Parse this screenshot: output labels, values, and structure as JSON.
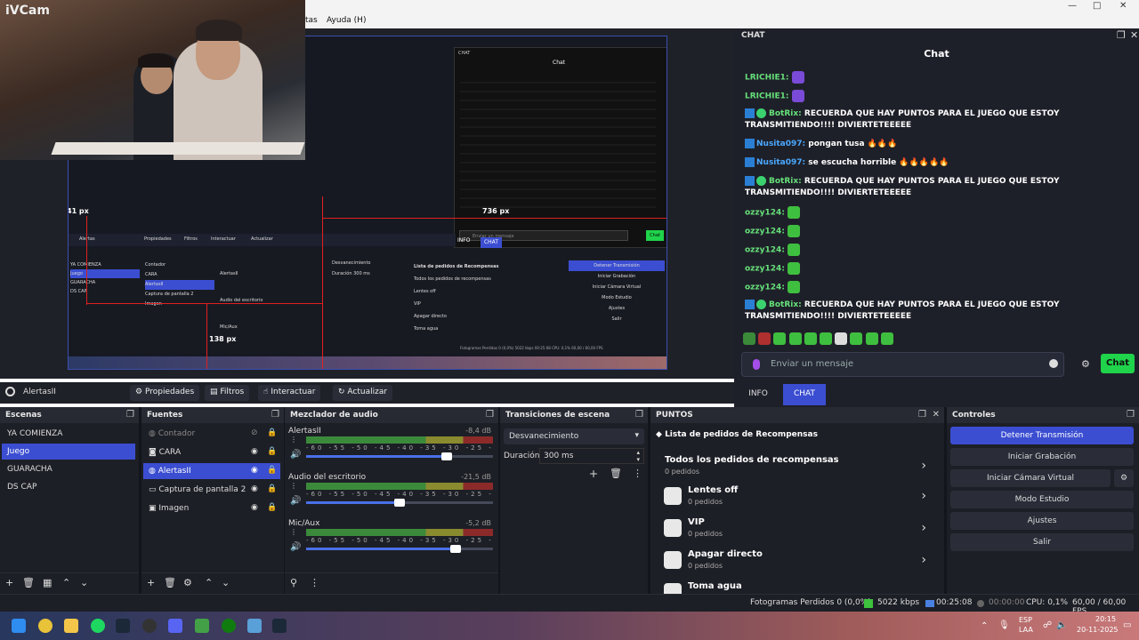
{
  "menu": {
    "item1": "tas",
    "item2": "Ayuda (H)"
  },
  "webcam": {
    "label": "iVCam"
  },
  "preview": {
    "marker_left": "41 px",
    "marker_bottom": "138 px",
    "marker_chat": "736 px",
    "nested_chat_title": "Chat",
    "nested_chat_header": "CHAT",
    "nested_tabs": [
      "INFO",
      "CHAT"
    ],
    "nested_send": "Chat",
    "nested_input_placeholder": "Enviar un mensaje",
    "nested_source": "Alertas",
    "nested_toolbar": [
      "Propiedades",
      "Filtros",
      "Interactuar",
      "Actualizar"
    ],
    "nested_scenes": [
      "YA COMIENZA",
      "Juego",
      "GUARACHA",
      "DS CAP"
    ],
    "nested_sources": [
      "Contador",
      "CARA",
      "AlertasII",
      "Captura de pantalla 2",
      "Imagen"
    ],
    "nested_mixer": [
      "AlertasII",
      "Audio del escritorio",
      "Mic/Aux"
    ],
    "nested_transition": "Desvanecimiento",
    "nested_duration_label": "Duración",
    "nested_duration": "300 ms",
    "nested_rewards_title": "Lista de pedidos de Recompensas",
    "nested_rewards_all": "Todos los pedidos de recompensas",
    "nested_rewards": [
      "Lentes off",
      "VIP",
      "Apagar directo",
      "Toma agua"
    ],
    "nested_controls": [
      "Detener Transmisión",
      "Iniciar Grabación",
      "Iniciar Cámara Virtual",
      "Modo Estudio",
      "Ajustes",
      "Salir"
    ],
    "nested_status": "Fotogramas Perdidos 0 (0,0%)   5022 kbps   00:25:08   CPU: 0,1%   60,00 / 60,00 FPS"
  },
  "chat_dock": {
    "header": "CHAT",
    "title": "Chat",
    "messages": [
      {
        "user": "LRICHIE1:",
        "text": "",
        "emote": true
      },
      {
        "user": "LRICHIE1:",
        "text": "",
        "emote": true
      },
      {
        "user": "BotRix:",
        "text": "RECUERDA QUE HAY PUNTOS PARA EL JUEGO QUE ESTOY TRANSMITIENDO!!!! DIVIERTETEEEEE",
        "bot": true
      },
      {
        "user": "Nusita097:",
        "text": "pongan tusa 🔥🔥🔥"
      },
      {
        "user": "Nusita097:",
        "text": "se escucha horrible 🔥🔥🔥🔥🔥"
      },
      {
        "user": "BotRix:",
        "text": "RECUERDA QUE HAY PUNTOS PARA EL JUEGO QUE ESTOY TRANSMITIENDO!!!! DIVIERTETEEEEE",
        "bot": true
      },
      {
        "user": "ozzy124:",
        "text": "",
        "emote": true
      },
      {
        "user": "ozzy124:",
        "text": "",
        "emote": true
      },
      {
        "user": "ozzy124:",
        "text": "",
        "emote": true
      },
      {
        "user": "ozzy124:",
        "text": "",
        "emote": true
      },
      {
        "user": "ozzy124:",
        "text": "",
        "emote": true
      },
      {
        "user": "BotRix:",
        "text": "RECUERDA QUE HAY PUNTOS PARA EL JUEGO QUE ESTOY TRANSMITIENDO!!!! DIVIERTETEEEEE",
        "bot": true
      }
    ],
    "input_placeholder": "Enviar un mensaje",
    "send_label": "Chat",
    "tabs": [
      "INFO",
      "CHAT"
    ],
    "active_tab": "CHAT"
  },
  "source_toolbar": {
    "source_name": "AlertasII",
    "properties": "Propiedades",
    "filters": "Filtros",
    "interact": "Interactuar",
    "refresh": "Actualizar"
  },
  "scenes": {
    "title": "Escenas",
    "items": [
      "YA COMIENZA",
      "Juego",
      "GUARACHA",
      "DS CAP"
    ],
    "selected": "Juego"
  },
  "sources": {
    "title": "Fuentes",
    "items": [
      "Contador",
      "CARA",
      "AlertasII",
      "Captura de pantalla 2",
      "Imagen"
    ],
    "selected": "AlertasII"
  },
  "mixer": {
    "title": "Mezclador de audio",
    "channels": [
      {
        "name": "AlertasII",
        "db": "-8,4 dB",
        "volume": 0.75
      },
      {
        "name": "Audio del escritorio",
        "db": "-21,5 dB",
        "volume": 0.5
      },
      {
        "name": "Mic/Aux",
        "db": "-5,2 dB",
        "volume": 0.8
      }
    ],
    "scale": "-60 -55 -50 -45 -40 -35 -30 -25 -20 -15 -10 -5 0"
  },
  "transitions": {
    "title": "Transiciones de escena",
    "selected": "Desvanecimiento",
    "duration_label": "Duración",
    "duration": "300 ms"
  },
  "points": {
    "title": "PUNTOS",
    "list_title": "Lista de pedidos de Recompensas",
    "all_title": "Todos los pedidos de recompensas",
    "all_sub": "0 pedidos",
    "rewards": [
      {
        "name": "Lentes off",
        "sub": "0 pedidos"
      },
      {
        "name": "VIP",
        "sub": "0 pedidos"
      },
      {
        "name": "Apagar directo",
        "sub": "0 pedidos"
      },
      {
        "name": "Toma agua",
        "sub": ""
      }
    ]
  },
  "controls": {
    "title": "Controles",
    "buttons": [
      "Detener Transmisión",
      "Iniciar Grabación",
      "Iniciar Cámara Virtual",
      "Modo Estudio",
      "Ajustes",
      "Salir"
    ]
  },
  "statusbar": {
    "frames": "Fotogramas Perdidos 0 (0,0%)",
    "kbps": "5022 kbps",
    "stream_time": "00:25:08",
    "rec_time": "00:00:00",
    "cpu": "CPU: 0,1%",
    "fps": "60,00 / 60,00 FPS"
  },
  "taskbar": {
    "lang": "ESP",
    "layout": "LAA",
    "time": "20:15",
    "date": "20-11-2025"
  },
  "colors": {
    "accent": "#3b4ed1",
    "send": "#1fd34b",
    "live": "#e02020"
  }
}
